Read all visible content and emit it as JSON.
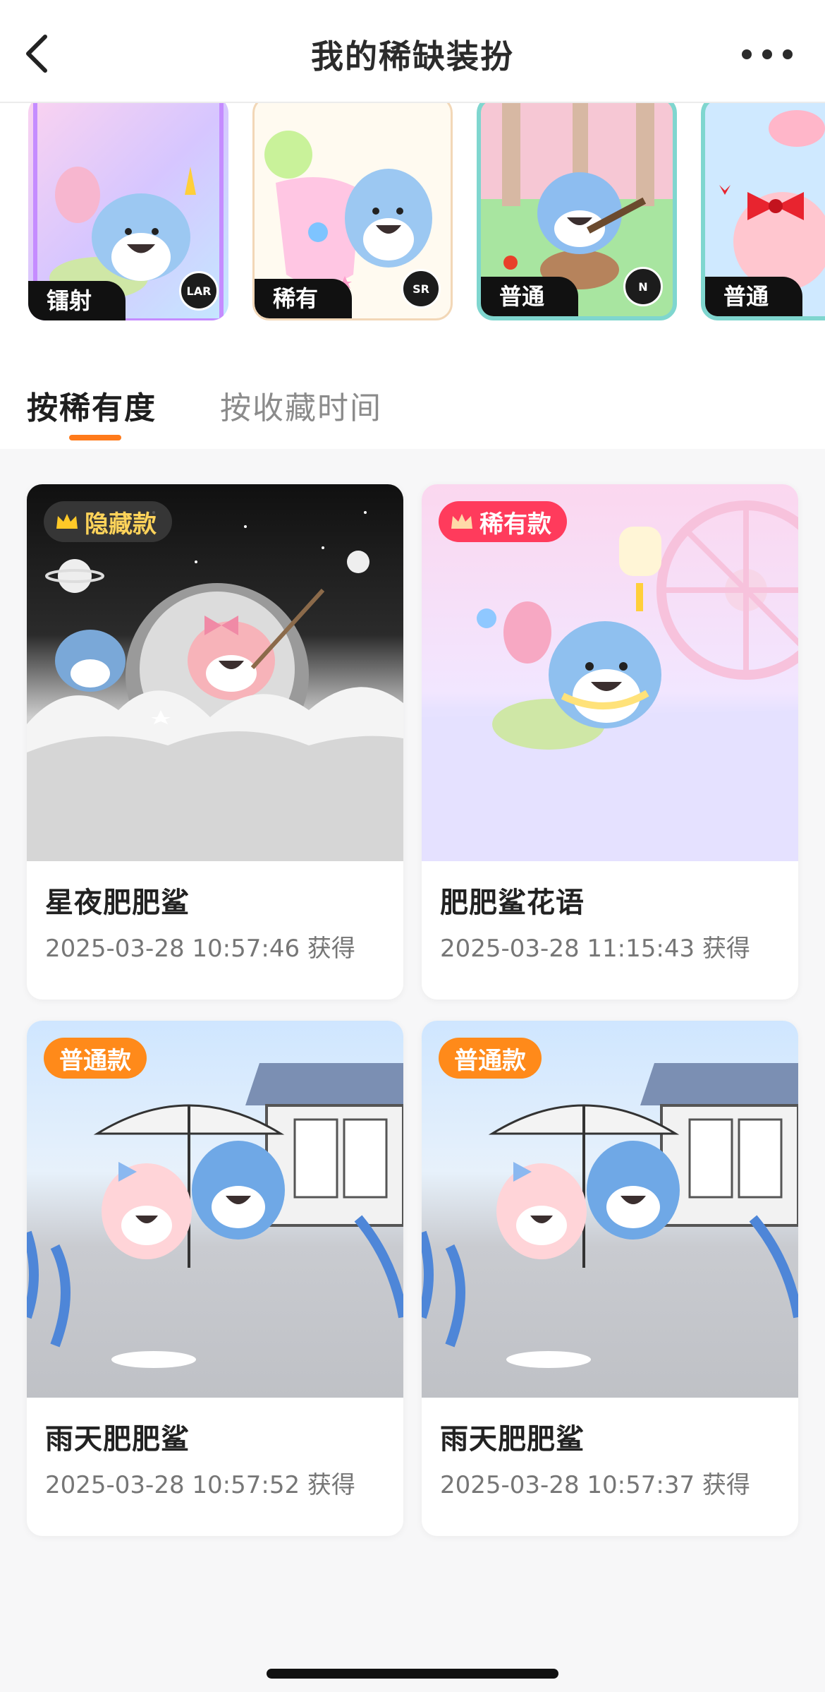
{
  "header": {
    "title": "我的稀缺装扮"
  },
  "strip": {
    "cards": [
      {
        "tag": "镭射",
        "badge": "LAR"
      },
      {
        "tag": "稀有",
        "badge": "SR"
      },
      {
        "tag": "普通",
        "badge": "N"
      },
      {
        "tag": "普通",
        "badge": ""
      }
    ]
  },
  "tabs": {
    "active": "按稀有度",
    "inactive": "按收藏时间"
  },
  "items": [
    {
      "rarity": "隐藏款",
      "name": "星夜肥肥鲨",
      "time": "2025-03-28 10:57:46 获得"
    },
    {
      "rarity": "稀有款",
      "name": "肥肥鲨花语",
      "time": "2025-03-28 11:15:43 获得"
    },
    {
      "rarity": "普通款",
      "name": "雨天肥肥鲨",
      "time": "2025-03-28 10:57:52 获得"
    },
    {
      "rarity": "普通款",
      "name": "雨天肥肥鲨",
      "time": "2025-03-28 10:57:37 获得"
    }
  ],
  "colors": {
    "accent": "#ff7a1a",
    "hidden_badge": "#3a3a3a",
    "rare_badge": "#ff3b5c",
    "normal_badge": "#ff8a1a"
  },
  "icons": [
    "back-icon",
    "more-icon",
    "crown-icon",
    "shark-illustration"
  ]
}
